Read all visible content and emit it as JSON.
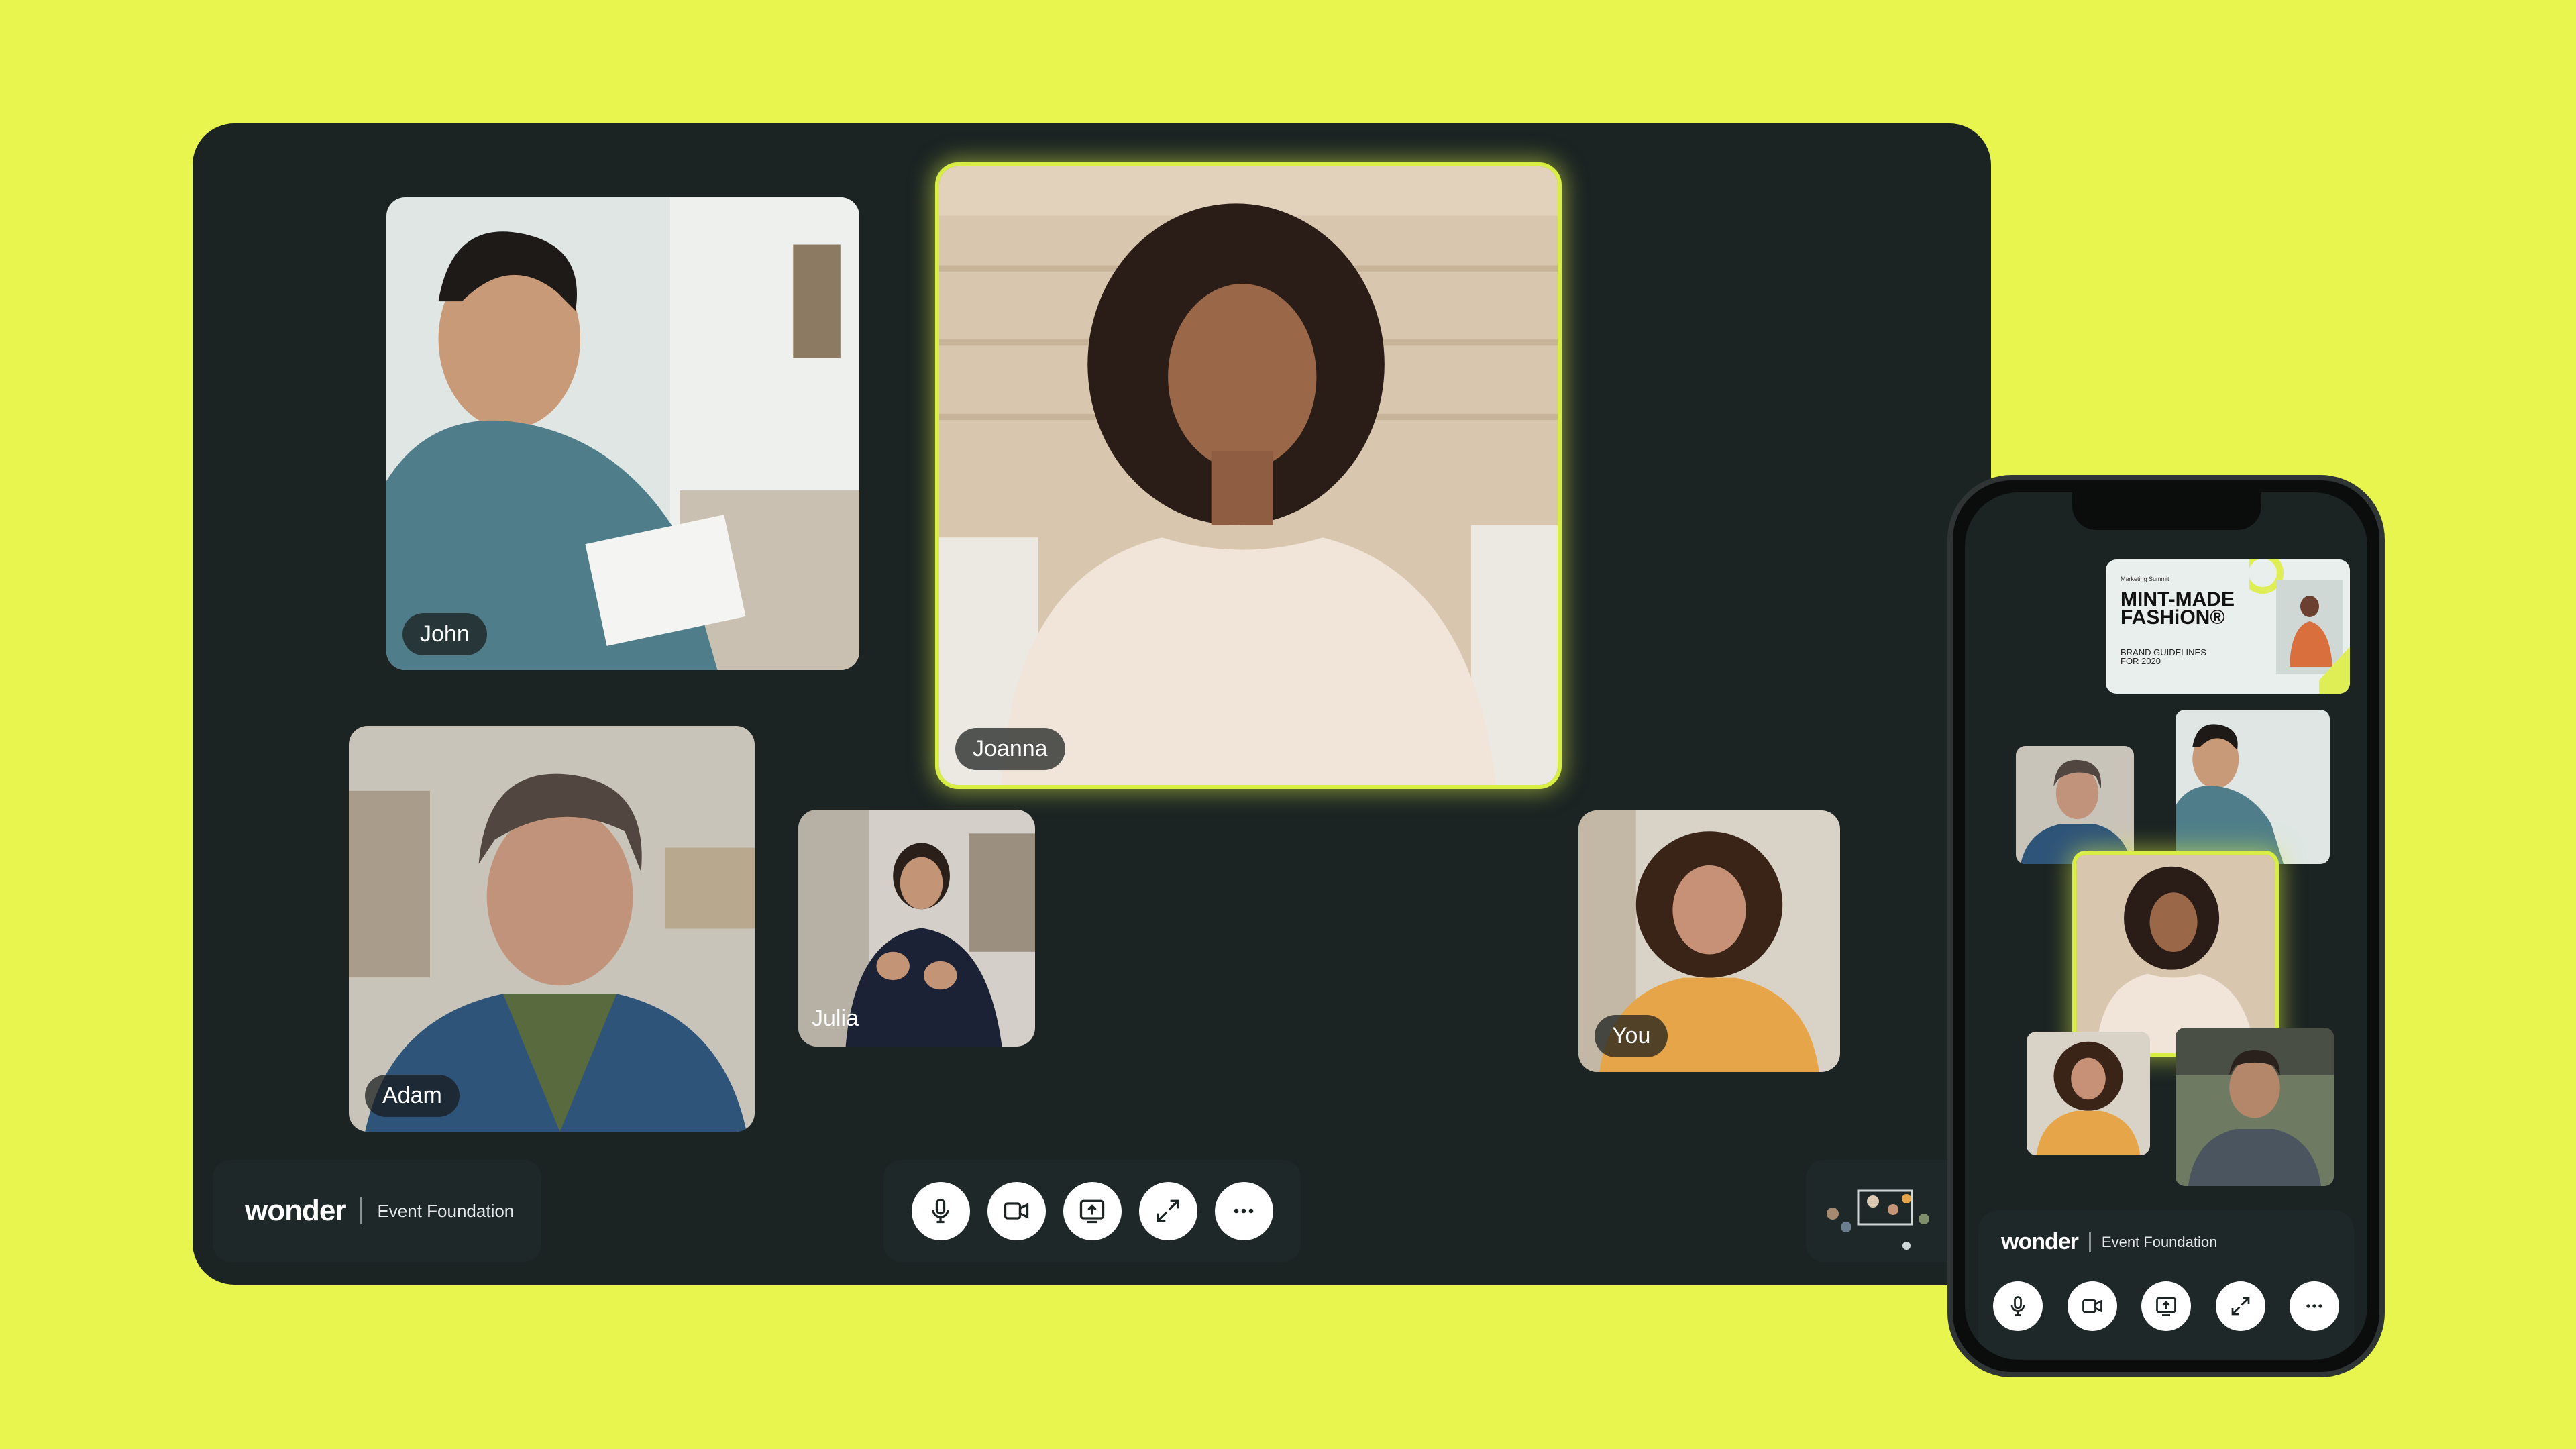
{
  "brand": {
    "logo": "wonder",
    "event": "Event Foundation"
  },
  "participants": {
    "john": "John",
    "joanna": "Joanna",
    "adam": "Adam",
    "julia": "Julia",
    "you": "You"
  },
  "controls": {
    "microphone": "mic-icon",
    "camera": "camera-icon",
    "share_screen": "share-screen-icon",
    "expand": "expand-icon",
    "more": "more-icon"
  },
  "phone": {
    "slide": {
      "kicker": "Marketing Summit",
      "title": "MINT-MADE FASHiON®",
      "subtitle": "BRAND GUIDELINES FOR 2020"
    }
  },
  "colors": {
    "background": "#e8f54e",
    "panel": "#1b2323",
    "active_highlight": "#d8ee45"
  }
}
